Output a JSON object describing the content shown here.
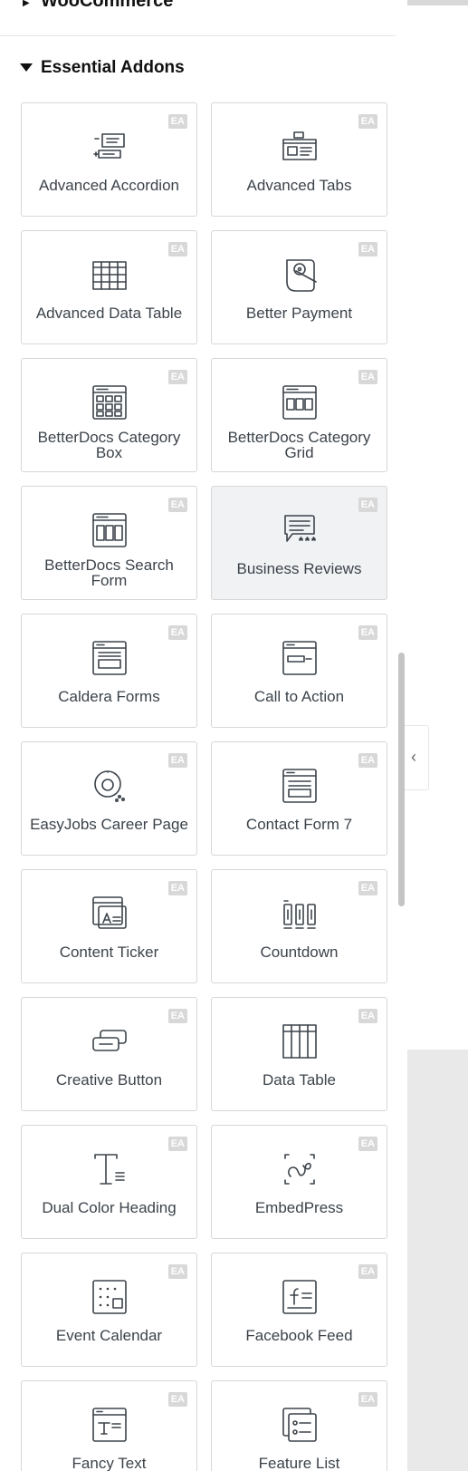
{
  "previous_section": {
    "title": "WooCommerce"
  },
  "section": {
    "title": "Essential Addons",
    "expanded": true
  },
  "badge_text": "EA",
  "widgets": [
    {
      "label": "Advanced Accordion",
      "icon": "accordion-icon"
    },
    {
      "label": "Advanced Tabs",
      "icon": "tabs-icon"
    },
    {
      "label": "Advanced Data Table",
      "icon": "data-table-icon"
    },
    {
      "label": "Better Payment",
      "icon": "payment-icon"
    },
    {
      "label": "BetterDocs Category Box",
      "icon": "category-box-icon"
    },
    {
      "label": "BetterDocs Category Grid",
      "icon": "category-grid-icon"
    },
    {
      "label": "BetterDocs Search Form",
      "icon": "search-form-icon"
    },
    {
      "label": "Business Reviews",
      "icon": "reviews-icon",
      "hovered": true
    },
    {
      "label": "Caldera Forms",
      "icon": "caldera-forms-icon"
    },
    {
      "label": "Call to Action",
      "icon": "call-to-action-icon"
    },
    {
      "label": "EasyJobs Career Page",
      "icon": "easyjobs-icon"
    },
    {
      "label": "Contact Form 7",
      "icon": "contact-form-icon"
    },
    {
      "label": "Content Ticker",
      "icon": "content-ticker-icon"
    },
    {
      "label": "Countdown",
      "icon": "countdown-icon"
    },
    {
      "label": "Creative Button",
      "icon": "creative-button-icon"
    },
    {
      "label": "Data Table",
      "icon": "table-icon"
    },
    {
      "label": "Dual Color Heading",
      "icon": "dual-heading-icon"
    },
    {
      "label": "EmbedPress",
      "icon": "embedpress-icon"
    },
    {
      "label": "Event Calendar",
      "icon": "event-calendar-icon"
    },
    {
      "label": "Facebook Feed",
      "icon": "facebook-feed-icon"
    },
    {
      "label": "Fancy Text",
      "icon": "fancy-text-icon"
    },
    {
      "label": "Feature List",
      "icon": "feature-list-icon"
    }
  ],
  "collapse_tab": {
    "glyph": "‹"
  },
  "colors": {
    "badge": "#d8d8d8",
    "icon_stroke": "#3c434a",
    "card_border": "#d7d7d7",
    "hover_bg": "#f1f2f4"
  }
}
